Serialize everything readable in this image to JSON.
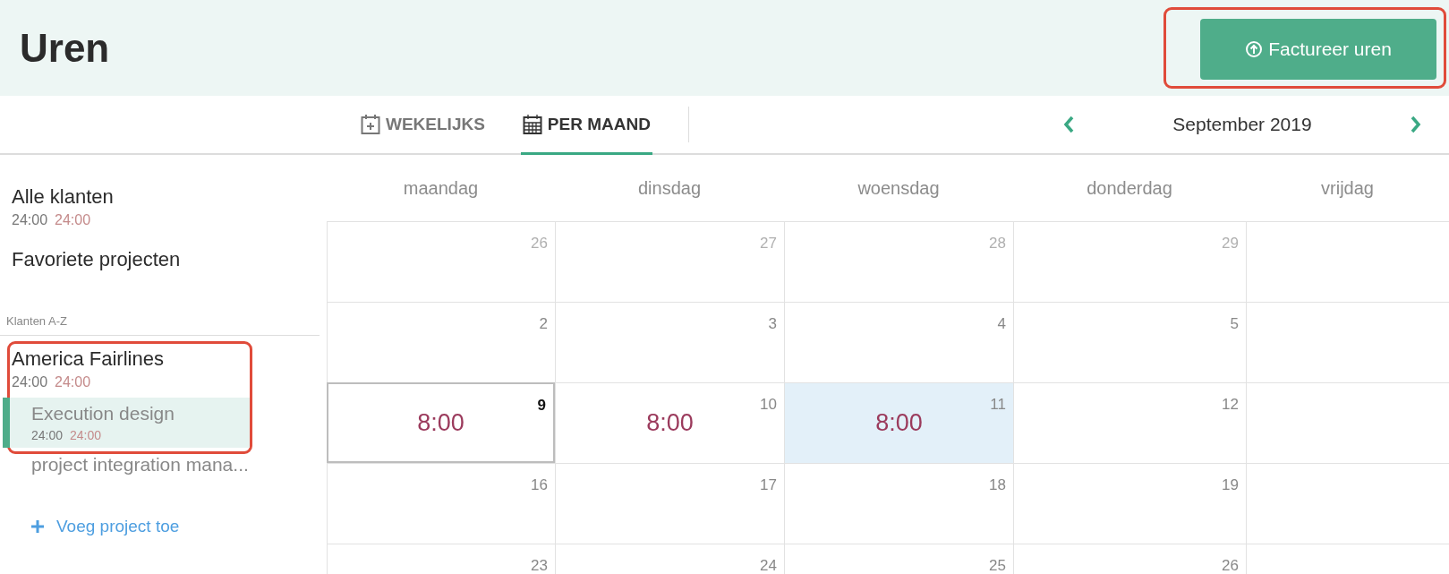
{
  "header": {
    "title": "Uren",
    "action_button": {
      "label": "Factureer uren"
    }
  },
  "view_tabs": [
    {
      "label": "WEKELIJKS",
      "selected": false,
      "kind": "week"
    },
    {
      "label": "PER MAAND",
      "selected": true,
      "kind": "month"
    }
  ],
  "month_nav": {
    "label": "September 2019"
  },
  "sidebar": {
    "all_clients": {
      "name": "Alle klanten",
      "time_1": "24:00",
      "time_2": "24:00"
    },
    "favorites": {
      "name": "Favoriete projecten"
    },
    "section_label": "Klanten A-Z",
    "clients": [
      {
        "name": "America Fairlines",
        "time_1": "24:00",
        "time_2": "24:00",
        "projects": [
          {
            "name": "Execution design",
            "time_1": "24:00",
            "time_2": "24:00",
            "selected": true
          },
          {
            "name": "project integration mana...",
            "selected": false
          }
        ]
      }
    ],
    "add_project": "Voeg project toe"
  },
  "calendar": {
    "weekdays": [
      "maandag",
      "dinsdag",
      "woensdag",
      "donderdag",
      "vrijdag"
    ],
    "weeks": [
      [
        {
          "day": "26",
          "outside_month": true
        },
        {
          "day": "27",
          "outside_month": true
        },
        {
          "day": "28",
          "outside_month": true
        },
        {
          "day": "29",
          "outside_month": true
        }
      ],
      [
        {
          "day": "2",
          "outside_month": false
        },
        {
          "day": "3",
          "outside_month": false
        },
        {
          "day": "4",
          "outside_month": false
        },
        {
          "day": "5",
          "outside_month": false
        }
      ],
      [
        {
          "day": "9",
          "outside_month": false,
          "selected": true,
          "hours": "8:00"
        },
        {
          "day": "10",
          "outside_month": false,
          "hours": "8:00"
        },
        {
          "day": "11",
          "outside_month": false,
          "highlighted": true,
          "hours": "8:00"
        },
        {
          "day": "12",
          "outside_month": false
        }
      ],
      [
        {
          "day": "16",
          "outside_month": false
        },
        {
          "day": "17",
          "outside_month": false
        },
        {
          "day": "18",
          "outside_month": false
        },
        {
          "day": "19",
          "outside_month": false
        }
      ],
      [
        {
          "day": "23",
          "outside_month": false
        },
        {
          "day": "24",
          "outside_month": false
        },
        {
          "day": "25",
          "outside_month": false
        },
        {
          "day": "26",
          "outside_month": false
        }
      ]
    ]
  }
}
